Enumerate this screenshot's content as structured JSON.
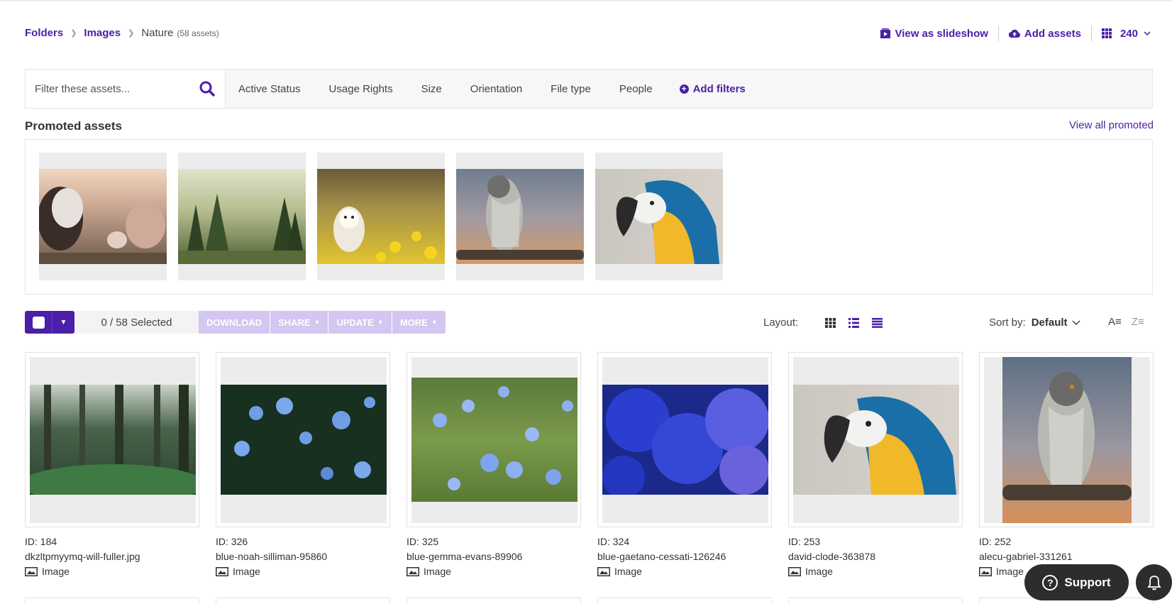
{
  "breadcrumb": {
    "folders": "Folders",
    "images": "Images",
    "current": "Nature",
    "count": "(58 assets)"
  },
  "top_actions": {
    "slideshow": "View as slideshow",
    "add_assets": "Add assets",
    "per_page": "240"
  },
  "filters": {
    "search_placeholder": "Filter these assets...",
    "items": [
      "Active Status",
      "Usage Rights",
      "Size",
      "Orientation",
      "File type",
      "People"
    ],
    "add_filters": "Add filters"
  },
  "promoted": {
    "title": "Promoted assets",
    "view_all": "View all promoted"
  },
  "toolbar": {
    "selected": "0  / 58 Selected",
    "download": "DOWNLOAD",
    "share": "SHARE",
    "update": "UPDATE",
    "more": "MORE",
    "layout_label": "Layout:",
    "sort_label": "Sort by:",
    "sort_value": "Default"
  },
  "assets": [
    {
      "id": "ID: 184",
      "name": "dkzltpmyymq-will-fuller.jpg",
      "type": "Image"
    },
    {
      "id": "ID: 326",
      "name": "blue-noah-silliman-95860",
      "type": "Image"
    },
    {
      "id": "ID: 325",
      "name": "blue-gemma-evans-89906",
      "type": "Image"
    },
    {
      "id": "ID: 324",
      "name": "blue-gaetano-cessati-126246",
      "type": "Image"
    },
    {
      "id": "ID: 253",
      "name": "david-clode-363878",
      "type": "Image"
    },
    {
      "id": "ID: 252",
      "name": "alecu-gabriel-331261",
      "type": "Image"
    }
  ],
  "support": {
    "label": "Support"
  },
  "colors": {
    "accent": "#4b1fa8",
    "accent_light": "#d3c6f0"
  }
}
